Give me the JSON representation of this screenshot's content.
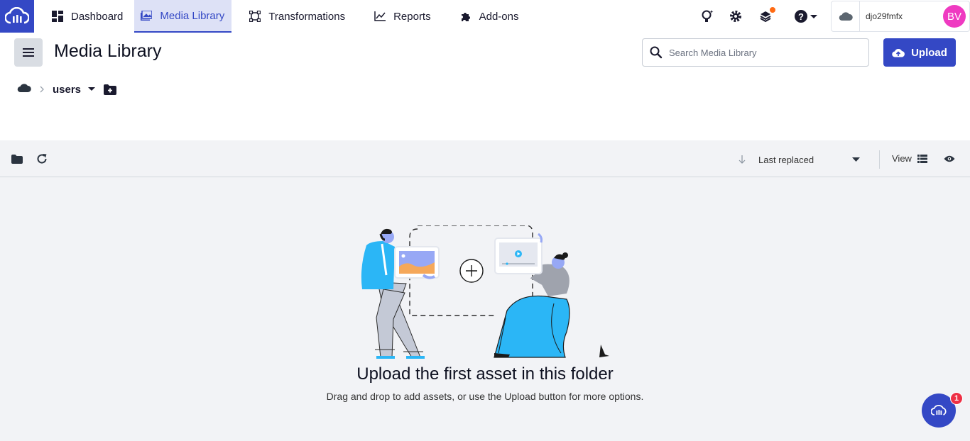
{
  "nav": {
    "items": [
      {
        "label": "Dashboard",
        "icon": "dashboard-icon",
        "active": false
      },
      {
        "label": "Media Library",
        "icon": "media-library-icon",
        "active": true
      },
      {
        "label": "Transformations",
        "icon": "transformations-icon",
        "active": false
      },
      {
        "label": "Reports",
        "icon": "reports-icon",
        "active": false
      },
      {
        "label": "Add-ons",
        "icon": "puzzle-icon",
        "active": false
      }
    ],
    "account": {
      "cloud_name": "djo29fmfx",
      "avatar_initials": "BV"
    }
  },
  "header": {
    "title": "Media Library",
    "search_placeholder": "Search Media Library",
    "upload_label": "Upload"
  },
  "breadcrumb": {
    "folder": "users"
  },
  "toolbar": {
    "sort_label": "Last replaced",
    "view_label": "View"
  },
  "empty_state": {
    "title": "Upload the first asset in this folder",
    "subtitle": "Drag and drop to add assets, or use the Upload button for more options."
  },
  "chat": {
    "badge_count": "1"
  },
  "colors": {
    "brand": "#3448c5",
    "avatar": "#ef3ac1",
    "notification": "#ff6a13",
    "badge": "#ee2f45"
  }
}
